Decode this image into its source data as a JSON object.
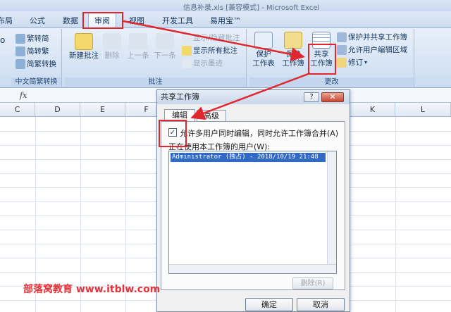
{
  "window": {
    "title": "信息补录.xls [兼容模式] - Microsoft Excel"
  },
  "tabs": [
    "布局",
    "公式",
    "数据",
    "审阅",
    "视图",
    "开发工具",
    "易用宝™"
  ],
  "active_tab": "审阅",
  "ribbon": {
    "groups": {
      "chinese": {
        "label": "中文简繁转换",
        "buttons": [
          "繁转简",
          "简转繁",
          "简繁转换"
        ]
      },
      "comments": {
        "label": "批注",
        "buttons": [
          "新建批注",
          "删除",
          "上一条",
          "下一条"
        ],
        "side_buttons": [
          "显示/隐藏批注",
          "显示所有批注",
          "显示墨迹"
        ]
      },
      "changes": {
        "label": "更改",
        "buttons": [
          {
            "label1": "保护",
            "label2": "工作表"
          },
          {
            "label1": "保护",
            "label2": "工作簿"
          },
          {
            "label1": "共享",
            "label2": "工作簿"
          }
        ],
        "side_buttons": [
          "保护并共享工作簿",
          "允许用户编辑区域",
          "修订"
        ]
      }
    },
    "stray_letter": "o"
  },
  "formula_bar": {
    "fx": "fx"
  },
  "columns": [
    "C",
    "D",
    "E",
    "F",
    "K",
    "L"
  ],
  "dialog": {
    "title": "共享工作簿",
    "help": "?",
    "close": "✕",
    "tabs": [
      "编辑",
      "高级"
    ],
    "checkbox_mark": "✓",
    "checkbox_label": "允许多用户同时编辑，同时允许工作簿合并(A)",
    "users_label": "正在使用本工作簿的用户(W):",
    "users": [
      "Administrator (独占) - 2018/10/19 21:48"
    ],
    "remove_button": "删除(R)",
    "ok_button": "确定",
    "cancel_button": "取消"
  },
  "watermark": "部落窝教育 www.itblw.com",
  "colors": {
    "accent_red": "#e1262d",
    "selection_blue": "#3169c6"
  }
}
